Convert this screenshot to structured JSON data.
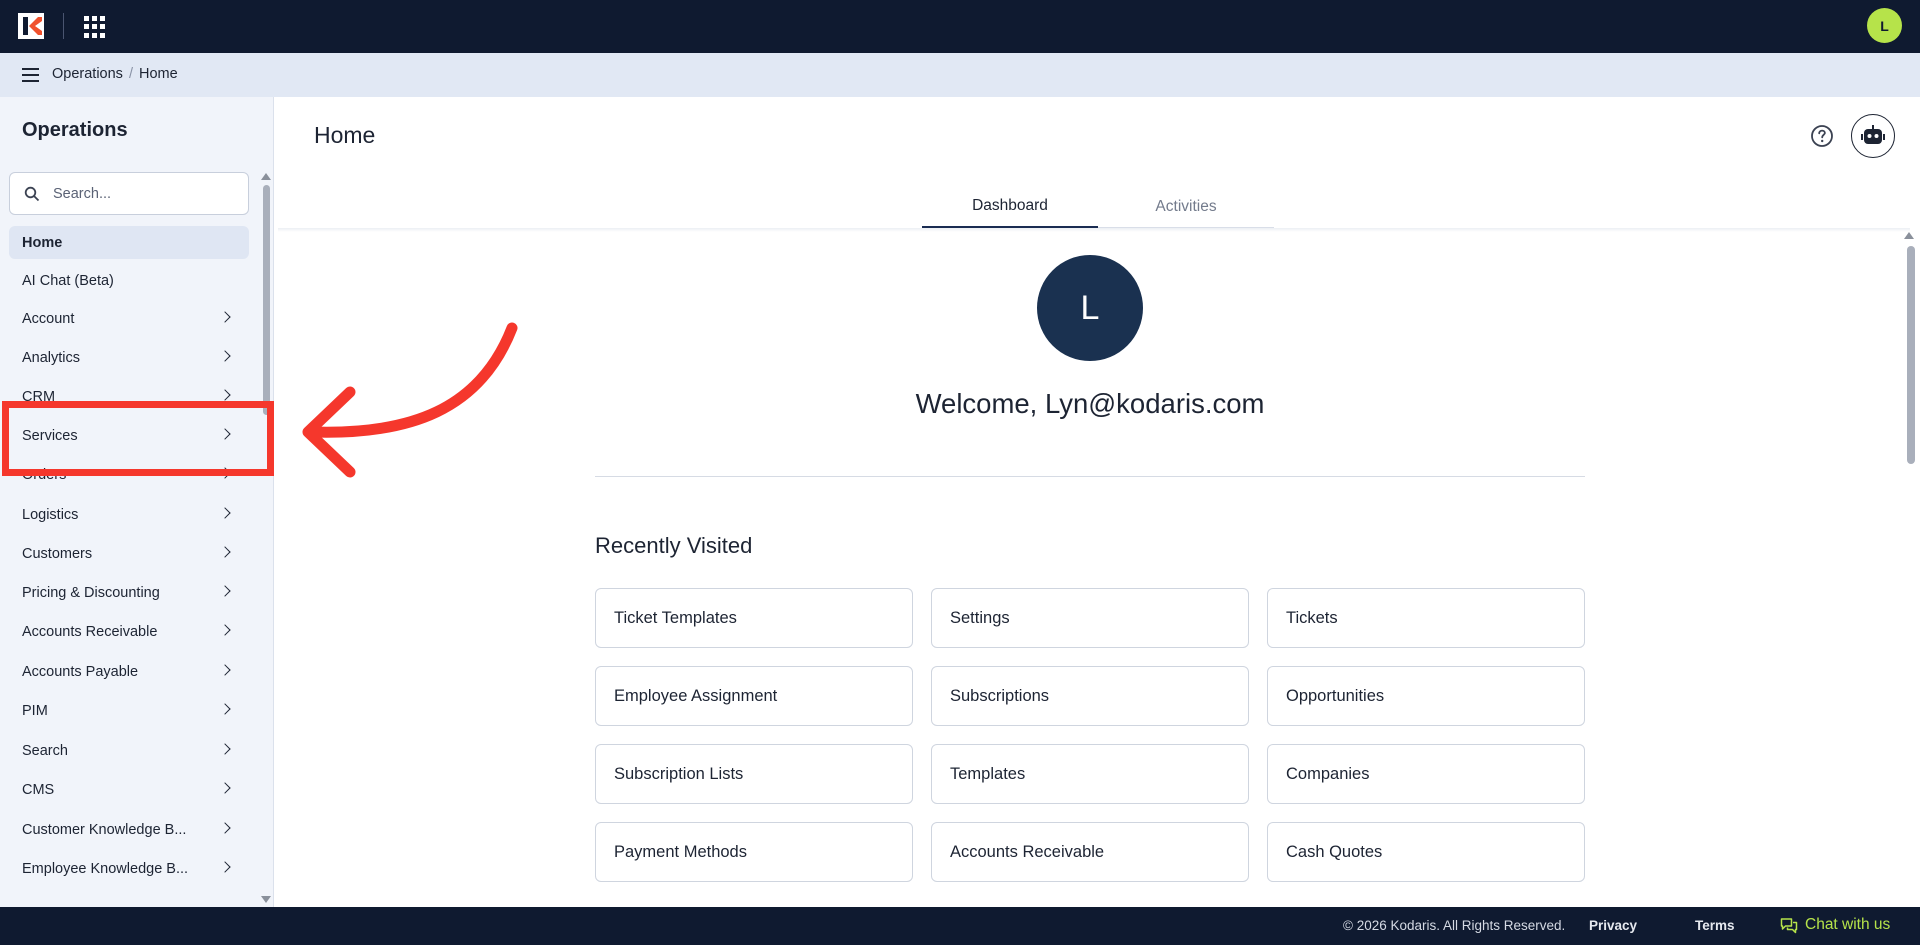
{
  "topbar": {
    "user_initial": "L",
    "brand_color": "#0f1a30",
    "avatar_color": "#b6e34a"
  },
  "breadcrumb": {
    "items": [
      "Operations",
      "Home"
    ],
    "separator": "/"
  },
  "sidebar": {
    "title": "Operations",
    "search_placeholder": "Search...",
    "items": [
      {
        "label": "Home",
        "active": true,
        "has_children": false
      },
      {
        "label": "AI Chat (Beta)",
        "active": false,
        "has_children": false
      },
      {
        "label": "Account",
        "active": false,
        "has_children": true
      },
      {
        "label": "Analytics",
        "active": false,
        "has_children": true
      },
      {
        "label": "CRM",
        "active": false,
        "has_children": true
      },
      {
        "label": "Services",
        "active": false,
        "has_children": true
      },
      {
        "label": "Orders",
        "active": false,
        "has_children": true
      },
      {
        "label": "Logistics",
        "active": false,
        "has_children": true
      },
      {
        "label": "Customers",
        "active": false,
        "has_children": true
      },
      {
        "label": "Pricing & Discounting",
        "active": false,
        "has_children": true
      },
      {
        "label": "Accounts Receivable",
        "active": false,
        "has_children": true
      },
      {
        "label": "Accounts Payable",
        "active": false,
        "has_children": true
      },
      {
        "label": "PIM",
        "active": false,
        "has_children": true
      },
      {
        "label": "Search",
        "active": false,
        "has_children": true
      },
      {
        "label": "CMS",
        "active": false,
        "has_children": true
      },
      {
        "label": "Customer Knowledge B...",
        "active": false,
        "has_children": true
      },
      {
        "label": "Employee Knowledge B...",
        "active": false,
        "has_children": true
      }
    ]
  },
  "annotation": {
    "highlight_color": "#f5372c",
    "highlighted_item": "Services"
  },
  "main": {
    "title": "Home",
    "tabs": [
      {
        "label": "Dashboard",
        "active": true
      },
      {
        "label": "Activities",
        "active": false
      }
    ],
    "avatar_initial": "L",
    "welcome": "Welcome, Lyn@kodaris.com",
    "recent_title": "Recently Visited",
    "recent_items": [
      "Ticket Templates",
      "Settings",
      "Tickets",
      "Employee Assignment",
      "Subscriptions",
      "Opportunities",
      "Subscription Lists",
      "Templates",
      "Companies",
      "Payment Methods",
      "Accounts Receivable",
      "Cash Quotes"
    ]
  },
  "footer": {
    "copyright": "© 2026 Kodaris. All Rights Reserved.",
    "privacy": "Privacy",
    "terms": "Terms",
    "chat": "Chat with us",
    "chat_color": "#b6e34a"
  }
}
